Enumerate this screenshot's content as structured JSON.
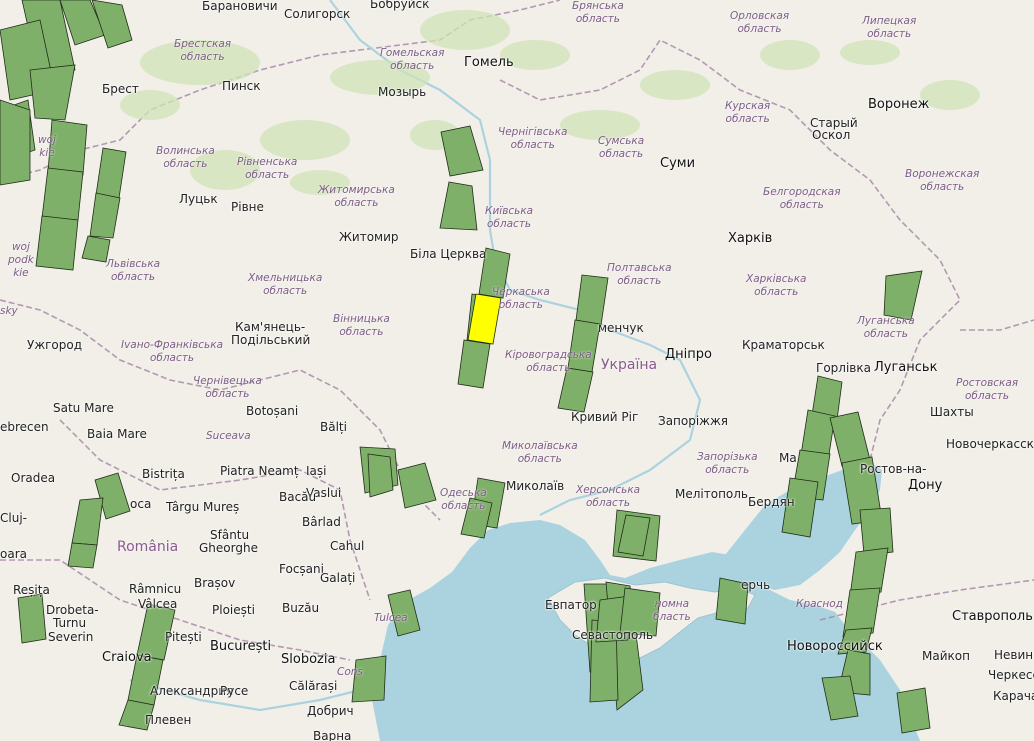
{
  "map": {
    "colors": {
      "land": "#f2efe9",
      "water": "#aad3df",
      "forest": "#cfe3b5",
      "footprint_fill": "#7fb069",
      "footprint_selected": "#ffff00",
      "footprint_stroke": "#1f2d18",
      "border": "#a78aa8"
    },
    "countries": [
      {
        "text": "Україна"
      },
      {
        "text": "România"
      }
    ],
    "cities": [
      {
        "text": "Барановичи"
      },
      {
        "text": "Солигорск"
      },
      {
        "text": "Бобруйск"
      },
      {
        "text": "Гомель"
      },
      {
        "text": "Брест"
      },
      {
        "text": "Пинск"
      },
      {
        "text": "Мозырь"
      },
      {
        "text": "Старый"
      },
      {
        "text": "Оскол"
      },
      {
        "text": "Воронеж"
      },
      {
        "text": "Суми"
      },
      {
        "text": "Луцьк"
      },
      {
        "text": "Рівне"
      },
      {
        "text": "Житомир"
      },
      {
        "text": "Харків"
      },
      {
        "text": "Біла Церква"
      },
      {
        "text": "Кам'янець-"
      },
      {
        "text": "Подільський"
      },
      {
        "text": "Ужгород"
      },
      {
        "text": "менчук"
      },
      {
        "text": "Дніпро"
      },
      {
        "text": "Краматорськ"
      },
      {
        "text": "Горлівка"
      },
      {
        "text": "Луганськ"
      },
      {
        "text": "Кривий Ріг"
      },
      {
        "text": "Запоріжжя"
      },
      {
        "text": "Шахты"
      },
      {
        "text": "Новочеркасск"
      },
      {
        "text": "Ростов-на-"
      },
      {
        "text": "Дону"
      },
      {
        "text": "Satu Mare"
      },
      {
        "text": "Baia Mare"
      },
      {
        "text": "Botoșani"
      },
      {
        "text": "Bălți"
      },
      {
        "text": "ebrecen"
      },
      {
        "text": "Oradea"
      },
      {
        "text": "Bistrița"
      },
      {
        "text": "Piatra Neamț"
      },
      {
        "text": "Iași"
      },
      {
        "text": "Vaslui"
      },
      {
        "text": "Târgu Mureș"
      },
      {
        "text": "Bacău"
      },
      {
        "text": "Bârlad"
      },
      {
        "text": "Миколаїв"
      },
      {
        "text": "Sfântu"
      },
      {
        "text": "Gheorghe"
      },
      {
        "text": "Cahul"
      },
      {
        "text": "Мелітополь"
      },
      {
        "text": "Бердян"
      },
      {
        "text": "Brașov"
      },
      {
        "text": "Focșani"
      },
      {
        "text": "Galați"
      },
      {
        "text": "Reșița"
      },
      {
        "text": "Râmnicu"
      },
      {
        "text": "Vâlcea"
      },
      {
        "text": "Drobeta-"
      },
      {
        "text": "Turnu"
      },
      {
        "text": "Severin"
      },
      {
        "text": "Ploiești"
      },
      {
        "text": "Buzău"
      },
      {
        "text": "Евпатор"
      },
      {
        "text": "Севастополь"
      },
      {
        "text": "ерчь"
      },
      {
        "text": "Новороссийск"
      },
      {
        "text": "Ставрополь"
      },
      {
        "text": "Craiova"
      },
      {
        "text": "Pitești"
      },
      {
        "text": "București"
      },
      {
        "text": "Slobozia"
      },
      {
        "text": "Călărași"
      },
      {
        "text": "Майкоп"
      },
      {
        "text": "Невин"
      },
      {
        "text": "Черкесс"
      },
      {
        "text": "Александрия"
      },
      {
        "text": "Русе"
      },
      {
        "text": "Плевен"
      },
      {
        "text": "Добрич"
      },
      {
        "text": "Варна"
      },
      {
        "text": "Карача"
      },
      {
        "text": "Cluj-"
      },
      {
        "text": "oara"
      },
      {
        "text": "oca"
      },
      {
        "text": "Ма"
      }
    ],
    "regions": [
      {
        "text": "Брестская\nобласть"
      },
      {
        "text": "Гомельская\nобласть"
      },
      {
        "text": "Брянська\nобласть"
      },
      {
        "text": "Орловская\nобласть"
      },
      {
        "text": "Липецкая\nобласть"
      },
      {
        "text": "Курская\nобласть"
      },
      {
        "text": "Чернігівська\nобласть"
      },
      {
        "text": "Сумська\nобласть"
      },
      {
        "text": "Волинська\nобласть"
      },
      {
        "text": "Рівненська\nобласть"
      },
      {
        "text": "Житомирська\nобласть"
      },
      {
        "text": "Київська\nобласть"
      },
      {
        "text": "Белгородская\nобласть"
      },
      {
        "text": "Воронежская\nобласть"
      },
      {
        "text": "Львівська\nобласть"
      },
      {
        "text": "Хмельницька\nобласть"
      },
      {
        "text": "Полтавська\nобласть"
      },
      {
        "text": "Харківська\nобласть"
      },
      {
        "text": "Вінницька\nобласть"
      },
      {
        "text": "Іvано-Франківська\nобласть"
      },
      {
        "text": "Черкаська\nобласть"
      },
      {
        "text": "Луганська\nобласть"
      },
      {
        "text": "Кіровоградська\nобласть"
      },
      {
        "text": "Чернівецька\nобласть"
      },
      {
        "text": "Ростовская\nобласть"
      },
      {
        "text": "Suceava"
      },
      {
        "text": "Миколаївська\nобласть"
      },
      {
        "text": "Одеська\nобласть"
      },
      {
        "text": "Херсонська\nобласть"
      },
      {
        "text": "Запорізька\nобласть"
      },
      {
        "text": "Краснод"
      },
      {
        "text": "Tulcea"
      },
      {
        "text": "номна\nбласть"
      },
      {
        "text": "Cons"
      },
      {
        "text": "woj\nkie"
      },
      {
        "text": "woj\npodk\nkie"
      },
      {
        "text": "sky"
      }
    ]
  }
}
